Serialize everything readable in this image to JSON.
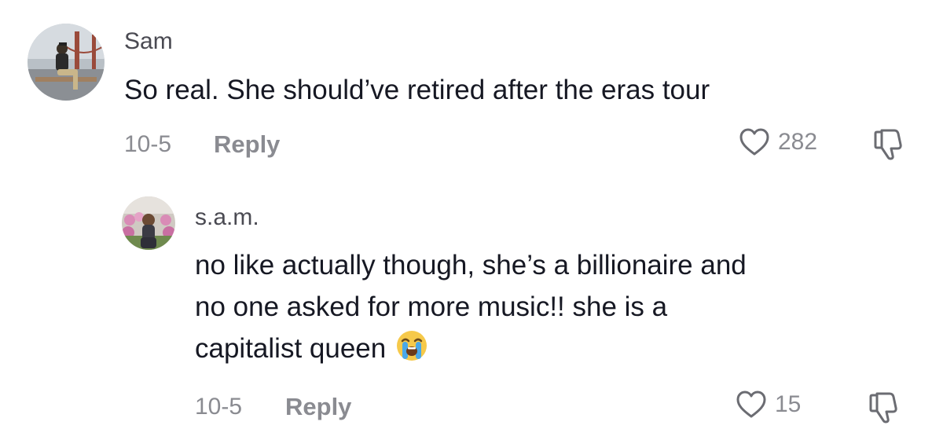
{
  "comments": [
    {
      "username": "Sam",
      "text_lines": [
        "So real. She should’ve retired after the eras tour"
      ],
      "date": "10-5",
      "reply_label": "Reply",
      "likes": "282",
      "avatar_icon": "avatar-golden-gate-photo",
      "replies": [
        {
          "username": "s.a.m.",
          "text_lines": [
            "no like actually though, she’s a billionaire and",
            "no one asked for more music!! she is a",
            "capitalist queen"
          ],
          "emoji_icon": "loudly-crying-face-emoji",
          "date": "10-5",
          "reply_label": "Reply",
          "likes": "15",
          "avatar_icon": "avatar-flower-field-photo"
        }
      ]
    }
  ],
  "icons": {
    "like": "heart-outline-icon",
    "dislike": "thumbs-down-outline-icon"
  },
  "colors": {
    "text": "#161823",
    "username": "#4a4a52",
    "secondary": "#8a8b91"
  }
}
